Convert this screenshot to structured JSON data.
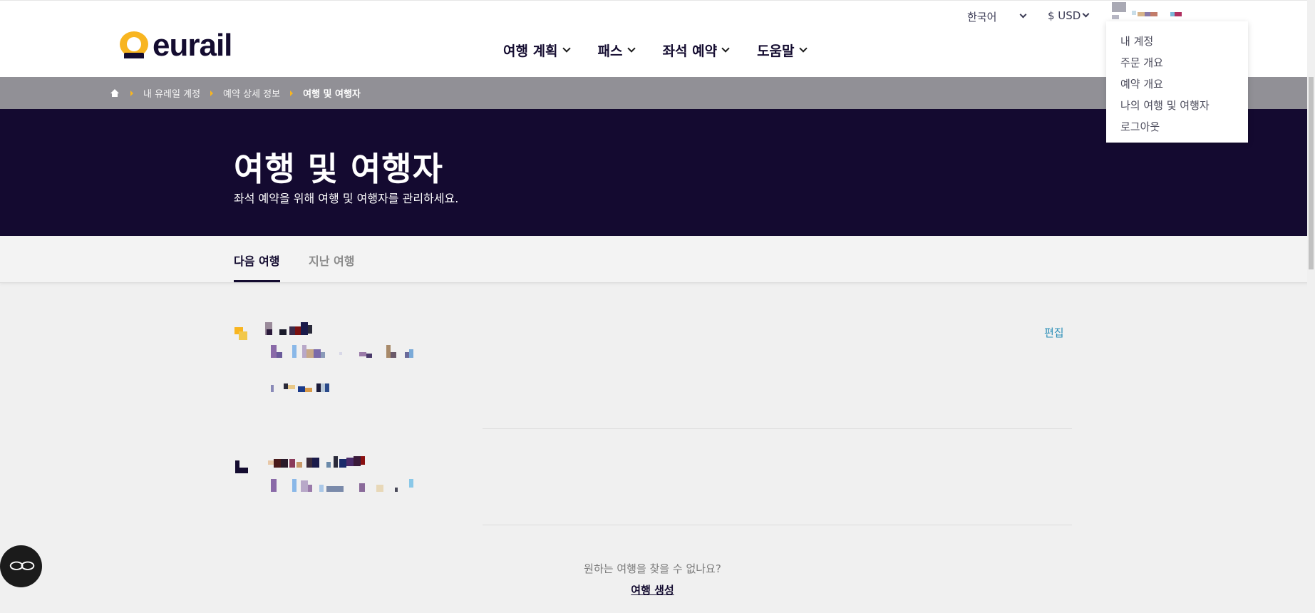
{
  "header": {
    "logo_text": "eurail",
    "language": "한국어",
    "currency": "$ USD",
    "nav": [
      {
        "label": "여행 계획"
      },
      {
        "label": "패스"
      },
      {
        "label": "좌석 예약"
      },
      {
        "label": "도움말"
      }
    ]
  },
  "account_menu": {
    "items": [
      {
        "label": "내 계정"
      },
      {
        "label": "주문 개요"
      },
      {
        "label": "예약 개요"
      },
      {
        "label": "나의 여행 및 여행자"
      },
      {
        "label": "로그아웃"
      }
    ]
  },
  "breadcrumb": {
    "items": [
      "내 유레일 계정",
      "예약 상세 정보"
    ],
    "current": "여행 및 여행자"
  },
  "hero": {
    "title": "여행 및 여행자",
    "subtitle": "좌석 예약을 위해 여행 및 여행자를 관리하세요."
  },
  "tabs": [
    {
      "label": "다음 여행",
      "active": true
    },
    {
      "label": "지난 여행",
      "active": false
    }
  ],
  "trips": {
    "edit_label": "편집"
  },
  "footer": {
    "question": "원하는 여행을 찾을 수 없나요?",
    "create_label": "여행 생성"
  },
  "chat": {
    "icon": "chat-loop-icon"
  },
  "colors": {
    "brand_yellow": "#f8b520",
    "brand_navy": "#140a30",
    "breadcrumb_bg": "#919096",
    "link_blue": "#2d8fb8"
  }
}
